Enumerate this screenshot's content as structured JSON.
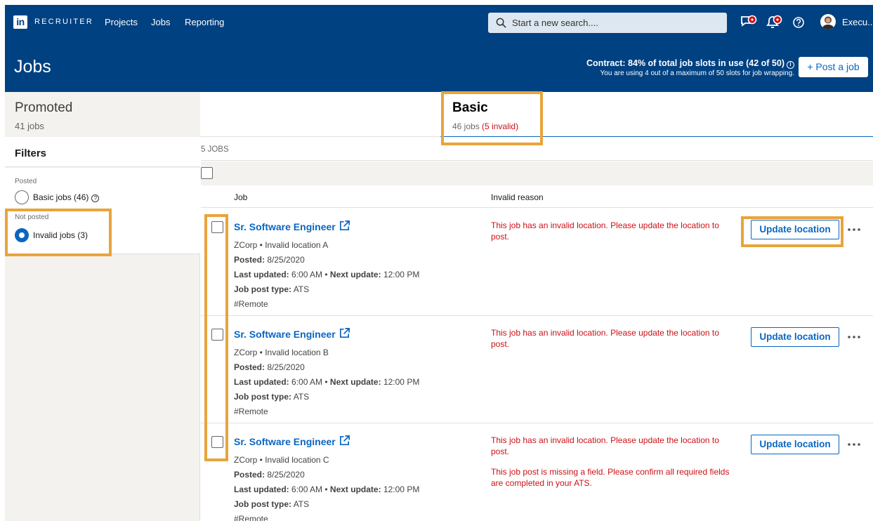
{
  "nav": {
    "brand": "RECRUITER",
    "links": [
      "Projects",
      "Jobs",
      "Reporting"
    ],
    "search_placeholder": "Start a new search....",
    "user_name": "Execu.."
  },
  "header": {
    "title": "Jobs",
    "contract_main": "Contract: 84% of total job slots in use (42 of 50)",
    "contract_sub": "You are using 4 out of a maximum of 50 slots for job wrapping.",
    "post_button": "+ Post a job"
  },
  "tabs": {
    "promoted": {
      "title": "Promoted",
      "sub": "41 jobs"
    },
    "basic": {
      "title": "Basic",
      "sub": "46 jobs",
      "invalid": "(5 invalid)"
    }
  },
  "filters": {
    "title": "Filters",
    "posted_label": "Posted",
    "basic_jobs": "Basic jobs (46)",
    "not_posted_label": "Not posted",
    "invalid_jobs": "Invalid jobs (3)"
  },
  "jobs": {
    "count_label": "5 JOBS",
    "col_job": "Job",
    "col_reason": "Invalid reason",
    "posted_key": "Posted:",
    "updated_key": "Last updated:",
    "next_key": "Next update:",
    "type_key": "Job post type:",
    "update_button": "Update location",
    "rows": [
      {
        "title": "Sr. Software Engineer",
        "company_location": "ZCorp • Invalid location A",
        "posted": "8/25/2020",
        "last_updated": "6:00 AM •",
        "next_update": "12:00 PM",
        "post_type": "ATS",
        "tag": "#Remote",
        "reasons": [
          "This job has an invalid location. Please update the location to post."
        ]
      },
      {
        "title": "Sr. Software Engineer",
        "company_location": "ZCorp • Invalid location B",
        "posted": "8/25/2020",
        "last_updated": "6:00 AM •",
        "next_update": "12:00 PM",
        "post_type": "ATS",
        "tag": "#Remote",
        "reasons": [
          "This job has an invalid location. Please update the location to post."
        ]
      },
      {
        "title": "Sr. Software Engineer",
        "company_location": "ZCorp • Invalid location C",
        "posted": "8/25/2020",
        "last_updated": "6:00 AM •",
        "next_update": "12:00 PM",
        "post_type": "ATS",
        "tag": "#Remote",
        "reasons": [
          "This job has an invalid location. Please update the location to post.",
          "This job post is missing a field. Please confirm all required fields are completed in your ATS."
        ]
      }
    ]
  },
  "colors": {
    "header_bg": "#004182",
    "link_blue": "#0a66c2",
    "error_red": "#cc1016",
    "highlight": "#e8a43b"
  }
}
